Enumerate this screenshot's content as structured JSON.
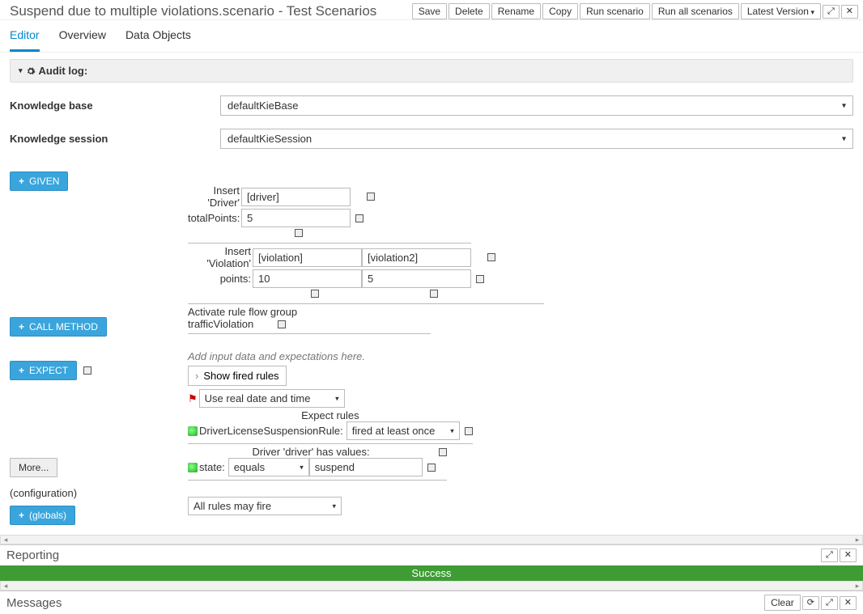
{
  "header": {
    "title": "Suspend due to multiple violations.scenario - Test Scenarios",
    "buttons": {
      "save": "Save",
      "delete": "Delete",
      "rename": "Rename",
      "copy": "Copy",
      "run": "Run scenario",
      "runall": "Run all scenarios",
      "version": "Latest Version"
    }
  },
  "tabs": {
    "editor": "Editor",
    "overview": "Overview",
    "dataobjects": "Data Objects"
  },
  "audit": {
    "label": "Audit log:"
  },
  "knowledge_base": {
    "label": "Knowledge base",
    "value": "defaultKieBase"
  },
  "knowledge_session": {
    "label": "Knowledge session",
    "value": "defaultKieSession"
  },
  "buttons": {
    "given": "GIVEN",
    "call": "CALL METHOD",
    "expect": "EXPECT",
    "more": "More...",
    "globals": "(globals)",
    "config": "(configuration)",
    "showfired": "Show fired rules"
  },
  "given": {
    "insert_driver": {
      "label": "Insert 'Driver'",
      "fact": "[driver]",
      "field": "totalPoints:",
      "value": "5"
    },
    "insert_violation": {
      "label": "Insert 'Violation'",
      "fact1": "[violation]",
      "fact2": "[violation2]",
      "field": "points:",
      "v1": "10",
      "v2": "5"
    },
    "ruleflow": {
      "label": "Activate rule flow group",
      "value": "trafficViolation"
    }
  },
  "hint": "Add input data and expectations here.",
  "expect": {
    "date_mode": "Use real date and time",
    "rules_label": "Expect rules",
    "rule_name": "DriverLicenseSuspensionRule:",
    "rule_mode": "fired at least once",
    "driver_label": "Driver 'driver' has values:",
    "field": "state:",
    "op": "equals",
    "val": "suspend"
  },
  "config_select": "All rules may fire",
  "reporting": {
    "label": "Reporting",
    "status": "Success"
  },
  "messages": {
    "label": "Messages",
    "clear": "Clear"
  }
}
